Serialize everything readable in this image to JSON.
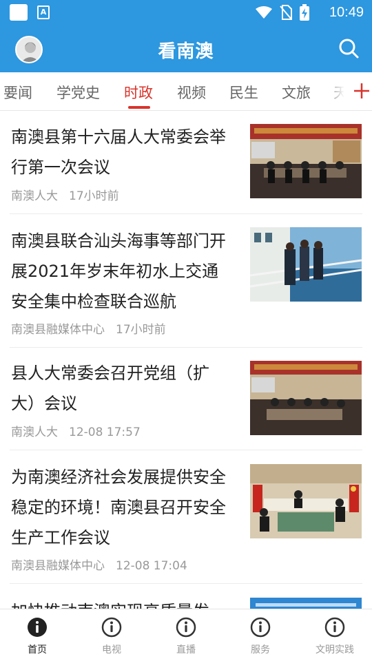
{
  "status_bar": {
    "time": "10:49",
    "icons": [
      "notification-square-icon",
      "app-a-icon",
      "wifi-icon",
      "no-sim-icon",
      "battery-charging-icon"
    ]
  },
  "header": {
    "title": "看南澳",
    "avatar_icon": "user-avatar-icon",
    "search_icon": "search-icon"
  },
  "tabs": {
    "items": [
      {
        "label": "要闻"
      },
      {
        "label": "学党史"
      },
      {
        "label": "时政",
        "active": true
      },
      {
        "label": "视频"
      },
      {
        "label": "民生"
      },
      {
        "label": "文旅"
      },
      {
        "label": "天"
      }
    ],
    "add_icon": "plus-icon"
  },
  "news": [
    {
      "title": "南澳县第十六届人大常委会举行第一次会议",
      "source": "南澳人大",
      "time": "17小时前",
      "thumb": "meeting-photo"
    },
    {
      "title": "南澳县联合汕头海事等部门开展2021年岁末年初水上交通安全集中检查联合巡航",
      "source": "南澳县融媒体中心",
      "time": "17小时前",
      "thumb": "ship-deck-photo"
    },
    {
      "title": "县人大常委会召开党组（扩大）会议",
      "source": "南澳人大",
      "time": "12-08 17:57",
      "thumb": "meeting-photo"
    },
    {
      "title": "为南澳经济社会发展提供安全稳定的环境！南澳县召开安全生产工作会议",
      "source": "南澳县融媒体中心",
      "time": "12-08 17:04",
      "thumb": "conference-photo"
    },
    {
      "title": "加快推动南澳实现高质量发",
      "thumb": "banner-photo"
    }
  ],
  "bottom_nav": [
    {
      "label": "首页",
      "icon": "info-icon",
      "active": true
    },
    {
      "label": "电视",
      "icon": "info-icon"
    },
    {
      "label": "直播",
      "icon": "info-icon"
    },
    {
      "label": "服务",
      "icon": "info-icon"
    },
    {
      "label": "文明实践",
      "icon": "info-icon"
    }
  ],
  "colors": {
    "brand_blue": "#2d97df",
    "accent_red": "#d9332b",
    "text_dark": "#222222",
    "text_meta": "#999999"
  }
}
